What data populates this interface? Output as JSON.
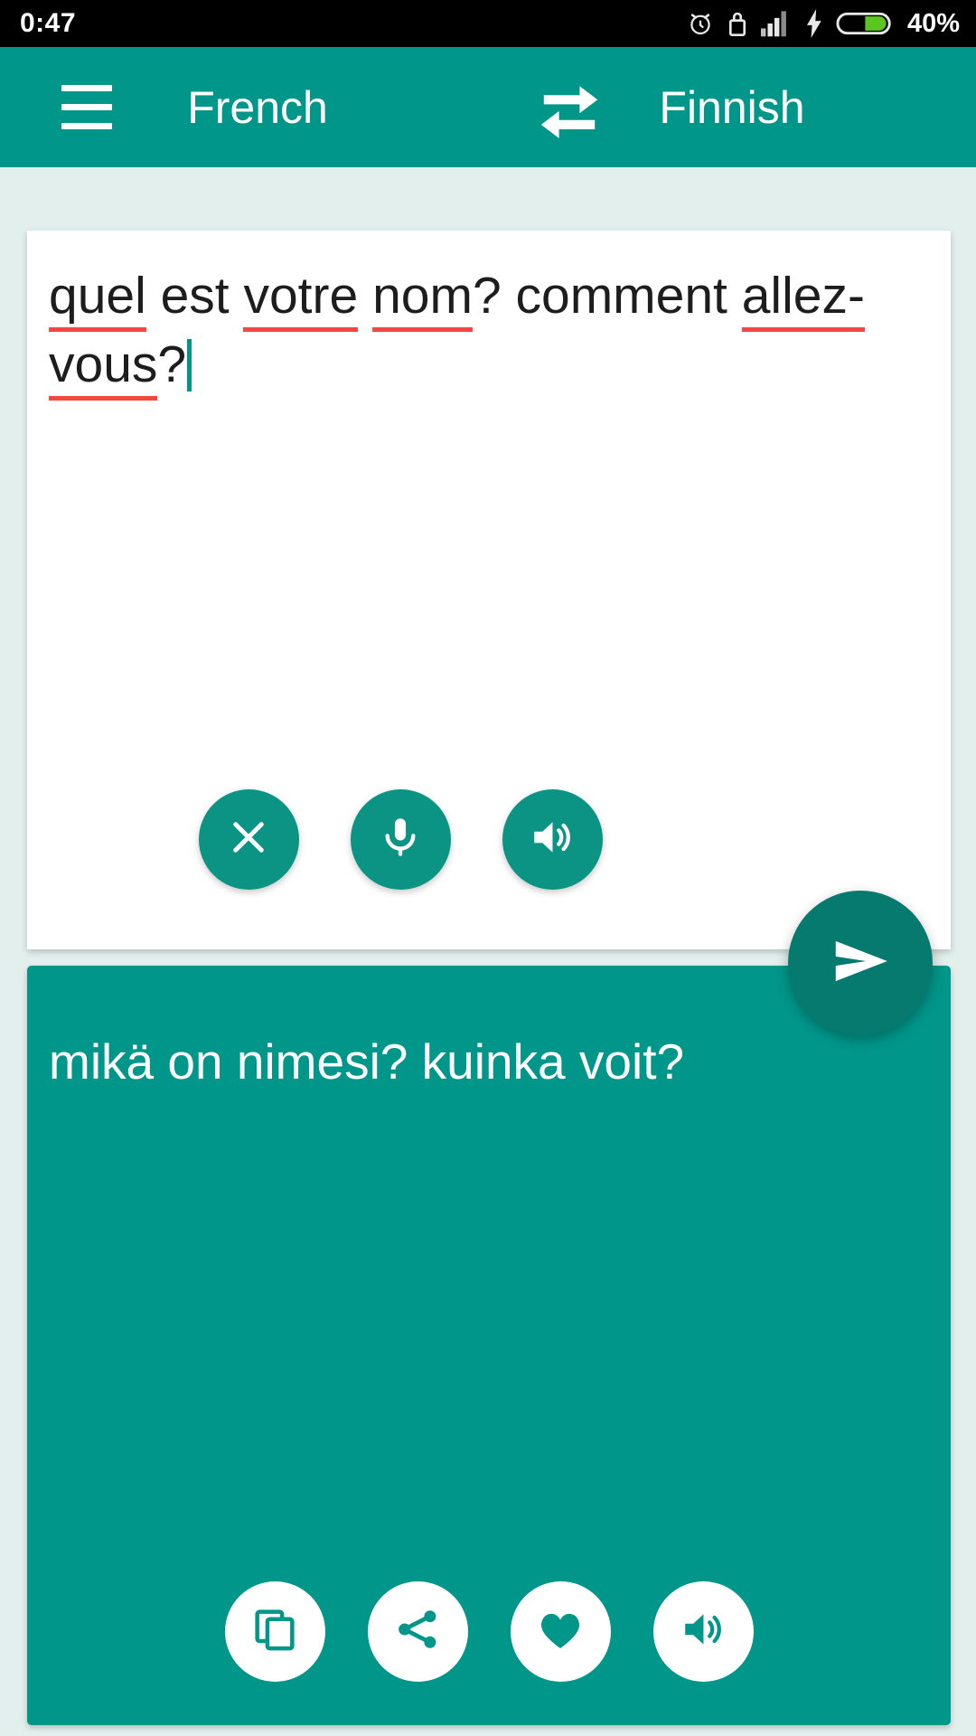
{
  "statusbar": {
    "clock": "0:47",
    "battery_percent": "40%",
    "icons": [
      "alarm-icon",
      "lock-icon",
      "signal-icon",
      "charging-bolt-icon",
      "battery-icon"
    ]
  },
  "appbar": {
    "menu_icon": "hamburger-menu-icon",
    "source_language": "French",
    "target_language": "Finnish",
    "swap_icon": "swap-languages-icon",
    "background_color": "#00968a"
  },
  "source_panel": {
    "text_segments": [
      {
        "text": "quel",
        "misspelled": true
      },
      {
        "text": " est ",
        "misspelled": false
      },
      {
        "text": "votre",
        "misspelled": true
      },
      {
        "text": " ",
        "misspelled": false
      },
      {
        "text": "nom",
        "misspelled": true
      },
      {
        "text": "? comment ",
        "misspelled": false
      },
      {
        "text": "allez-",
        "misspelled": true
      },
      {
        "text": "vous",
        "misspelled": true
      },
      {
        "text": "?",
        "misspelled": false
      }
    ],
    "full_text": "quel est votre nom? comment allez-vous?",
    "has_cursor": true,
    "spellcheck_underline_color": "#f4483f",
    "background_color": "#ffffff",
    "actions": [
      {
        "name": "clear-button",
        "icon": "close-icon"
      },
      {
        "name": "voice-input-button",
        "icon": "microphone-icon"
      },
      {
        "name": "speak-source-button",
        "icon": "speaker-icon"
      }
    ]
  },
  "send_button": {
    "name": "translate-send-button",
    "icon": "send-icon",
    "color": "#067a6e"
  },
  "result_panel": {
    "text": "mikä on nimesi? kuinka voit?",
    "background_color": "#00968a",
    "text_color": "#ffffff",
    "actions": [
      {
        "name": "copy-button",
        "icon": "copy-icon"
      },
      {
        "name": "share-button",
        "icon": "share-icon"
      },
      {
        "name": "favorite-button",
        "icon": "heart-icon"
      },
      {
        "name": "speak-result-button",
        "icon": "speaker-icon"
      }
    ]
  },
  "page": {
    "background_color": "#e2efed"
  }
}
